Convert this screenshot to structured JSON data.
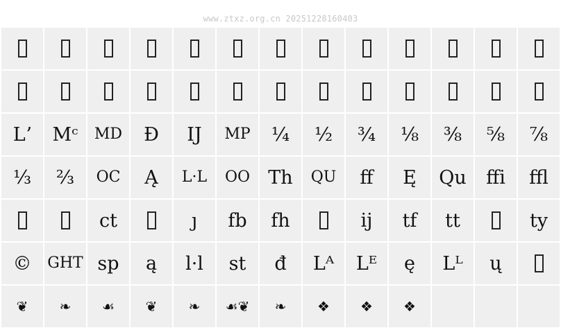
{
  "watermark": "www.ztxz.org.cn 20251228160403",
  "glyphs": [
    {
      "t": "",
      "kind": "missing"
    },
    {
      "t": "",
      "kind": "missing"
    },
    {
      "t": "",
      "kind": "missing"
    },
    {
      "t": "",
      "kind": "missing"
    },
    {
      "t": "",
      "kind": "missing"
    },
    {
      "t": "",
      "kind": "missing"
    },
    {
      "t": "",
      "kind": "missing"
    },
    {
      "t": "",
      "kind": "missing"
    },
    {
      "t": "",
      "kind": "missing"
    },
    {
      "t": "",
      "kind": "missing"
    },
    {
      "t": "",
      "kind": "missing"
    },
    {
      "t": "",
      "kind": "missing"
    },
    {
      "t": "",
      "kind": "missing"
    },
    {
      "t": "",
      "kind": "missing"
    },
    {
      "t": "",
      "kind": "missing"
    },
    {
      "t": "",
      "kind": "missing"
    },
    {
      "t": "",
      "kind": "missing"
    },
    {
      "t": "",
      "kind": "missing"
    },
    {
      "t": "",
      "kind": "missing"
    },
    {
      "t": "",
      "kind": "missing"
    },
    {
      "t": "",
      "kind": "missing"
    },
    {
      "t": "",
      "kind": "missing"
    },
    {
      "t": "",
      "kind": "missing"
    },
    {
      "t": "",
      "kind": "missing"
    },
    {
      "t": "",
      "kind": "missing"
    },
    {
      "t": "",
      "kind": "missing"
    },
    {
      "t": "Lʼ",
      "kind": "glyph"
    },
    {
      "t": "Mᶜ",
      "kind": "glyph"
    },
    {
      "t": "MD",
      "kind": "small"
    },
    {
      "t": "Đ",
      "kind": "glyph"
    },
    {
      "t": "IJ",
      "kind": "glyph"
    },
    {
      "t": "MP",
      "kind": "small"
    },
    {
      "t": "¼",
      "kind": "glyph"
    },
    {
      "t": "½",
      "kind": "glyph"
    },
    {
      "t": "¾",
      "kind": "glyph"
    },
    {
      "t": "⅛",
      "kind": "glyph"
    },
    {
      "t": "⅜",
      "kind": "glyph"
    },
    {
      "t": "⅝",
      "kind": "glyph"
    },
    {
      "t": "⅞",
      "kind": "glyph"
    },
    {
      "t": "⅓",
      "kind": "glyph"
    },
    {
      "t": "⅔",
      "kind": "glyph"
    },
    {
      "t": "OC",
      "kind": "small"
    },
    {
      "t": "Ą",
      "kind": "glyph"
    },
    {
      "t": "L·L",
      "kind": "small"
    },
    {
      "t": "OO",
      "kind": "small"
    },
    {
      "t": "Th",
      "kind": "glyph"
    },
    {
      "t": "QU",
      "kind": "small"
    },
    {
      "t": "ff",
      "kind": "glyph"
    },
    {
      "t": "Ę",
      "kind": "glyph"
    },
    {
      "t": "Qu",
      "kind": "glyph"
    },
    {
      "t": "ffi",
      "kind": "glyph"
    },
    {
      "t": "ffl",
      "kind": "glyph"
    },
    {
      "t": "",
      "kind": "missing"
    },
    {
      "t": "",
      "kind": "missing"
    },
    {
      "t": "ct",
      "kind": "glyph"
    },
    {
      "t": "",
      "kind": "missing"
    },
    {
      "t": "ȷ",
      "kind": "glyph"
    },
    {
      "t": "fb",
      "kind": "glyph"
    },
    {
      "t": "fh",
      "kind": "glyph"
    },
    {
      "t": "",
      "kind": "missing"
    },
    {
      "t": "ij",
      "kind": "glyph"
    },
    {
      "t": "tf",
      "kind": "glyph"
    },
    {
      "t": "tt",
      "kind": "glyph"
    },
    {
      "t": "",
      "kind": "missing"
    },
    {
      "t": "ty",
      "kind": "glyph"
    },
    {
      "t": "©",
      "kind": "glyph"
    },
    {
      "t": "GHT",
      "kind": "small"
    },
    {
      "t": "sp",
      "kind": "glyph"
    },
    {
      "t": "ą",
      "kind": "glyph"
    },
    {
      "t": "l·l",
      "kind": "glyph"
    },
    {
      "t": "st",
      "kind": "glyph"
    },
    {
      "t": "đ",
      "kind": "glyph"
    },
    {
      "t": "Lᴬ",
      "kind": "glyph"
    },
    {
      "t": "Lᴱ",
      "kind": "glyph"
    },
    {
      "t": "ę",
      "kind": "glyph"
    },
    {
      "t": "Lᴸ",
      "kind": "glyph"
    },
    {
      "t": "ų",
      "kind": "glyph"
    },
    {
      "t": "",
      "kind": "missing"
    },
    {
      "t": "❦",
      "kind": "orn"
    },
    {
      "t": "❧",
      "kind": "orn"
    },
    {
      "t": "☙",
      "kind": "orn"
    },
    {
      "t": "❦",
      "kind": "orn"
    },
    {
      "t": "❧",
      "kind": "orn"
    },
    {
      "t": "☙❦",
      "kind": "orn"
    },
    {
      "t": "❧",
      "kind": "orn"
    },
    {
      "t": "❖",
      "kind": "orn"
    },
    {
      "t": "❖",
      "kind": "orn"
    },
    {
      "t": "❖",
      "kind": "orn"
    },
    {
      "t": "",
      "kind": "empty"
    },
    {
      "t": "",
      "kind": "empty"
    },
    {
      "t": "",
      "kind": "empty"
    }
  ]
}
